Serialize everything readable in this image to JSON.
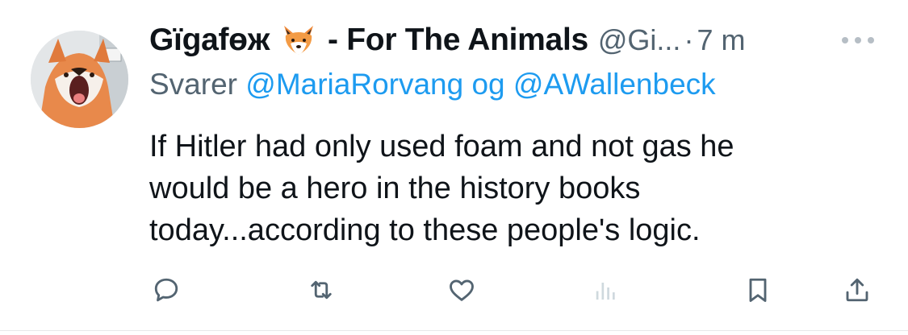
{
  "tweet": {
    "display_name": "Gïgafөж",
    "emoji_icon": "fox-face-emoji",
    "name_suffix": "- For The Animals",
    "handle": "@Gi...",
    "separator": "·",
    "time": "7 m",
    "reply_prefix": "Svarer",
    "reply_mention_1": "@MariaRorvang",
    "reply_joiner": "og",
    "reply_mention_2": "@AWallenbeck",
    "text_lines": [
      "If Hitler had only used foam and not gas he",
      "would be a hero in the history books",
      "today...according to these people's logic."
    ]
  },
  "colors": {
    "text_primary": "#0f1419",
    "text_secondary": "#536471",
    "link": "#1d9bf0",
    "divider": "#e7e9ea"
  },
  "actions": [
    {
      "name": "reply",
      "icon": "comment-icon"
    },
    {
      "name": "retweet",
      "icon": "retweet-icon"
    },
    {
      "name": "like",
      "icon": "heart-icon"
    },
    {
      "name": "views",
      "icon": "bar-chart-icon"
    },
    {
      "name": "bookmark",
      "icon": "bookmark-icon"
    },
    {
      "name": "share",
      "icon": "share-icon"
    }
  ]
}
